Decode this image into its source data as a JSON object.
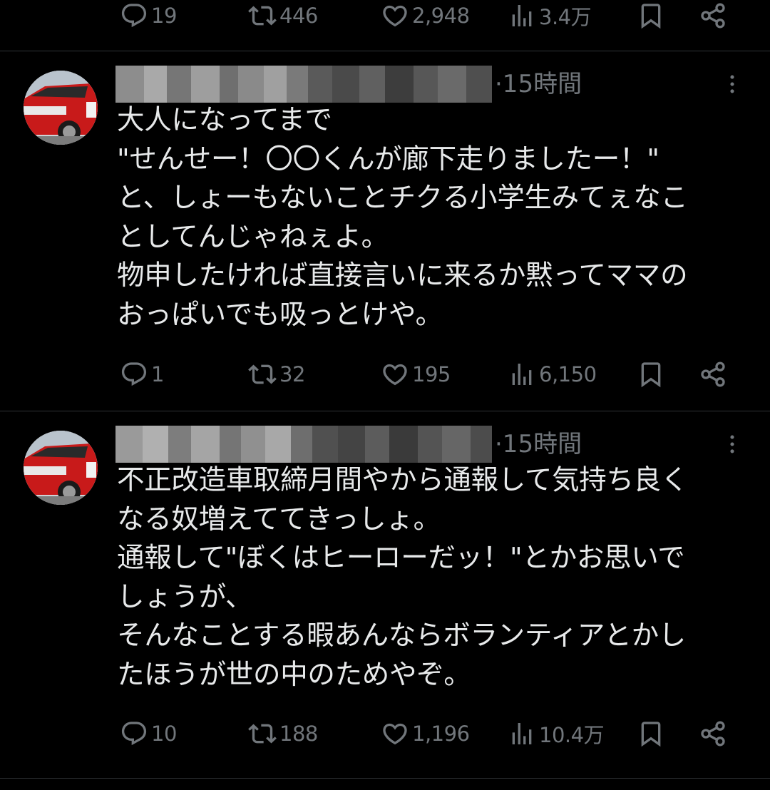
{
  "colors": {
    "background": "#000000",
    "text": "#e7e9ea",
    "muted": "#71767b",
    "separator": "#2f3336"
  },
  "icons": {
    "reply": "reply-icon",
    "retweet": "retweet-icon",
    "like": "heart-icon",
    "views": "views-icon",
    "bookmark": "bookmark-icon",
    "share": "share-icon",
    "more": "more-icon"
  },
  "top_actions": {
    "replies": "19",
    "retweets": "446",
    "likes": "2,948",
    "views": "3.4万"
  },
  "tweets": [
    {
      "author": "[blurred]",
      "time": "·15時間",
      "lines": [
        "大人になってまで",
        "\"せんせー！〇〇くんが廊下走りましたー！\"",
        "と、しょーもないことチクる小学生みてぇなこ",
        "としてんじゃねぇよ。",
        "物申したければ直接言いに来るか黙ってママの",
        "おっぱいでも吸っとけや。"
      ],
      "replies": "1",
      "retweets": "32",
      "likes": "195",
      "views": "6,150"
    },
    {
      "author": "[blurred]",
      "time": "·15時間",
      "lines": [
        "不正改造車取締月間やから通報して気持ち良く",
        "なる奴増えててきっしょ。",
        "通報して\"ぼくはヒーローだッ！\"とかお思いで",
        "しょうが、",
        "そんなことする暇あんならボランティアとかし",
        "たほうが世の中のためやぞ。"
      ],
      "replies": "10",
      "retweets": "188",
      "likes": "1,196",
      "views": "10.4万"
    }
  ]
}
